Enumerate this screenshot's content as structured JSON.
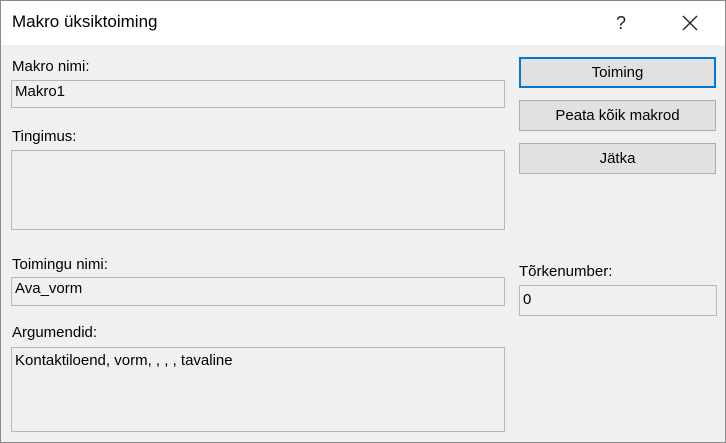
{
  "window": {
    "title": "Makro üksiktoiming",
    "help_label": "?"
  },
  "form": {
    "macro_name_label": "Makro nimi:",
    "macro_name_value": "Makro1",
    "condition_label": "Tingimus:",
    "condition_value": "",
    "action_name_label": "Toimingu nimi:",
    "action_name_value": "Ava_vorm",
    "arguments_label": "Argumendid:",
    "arguments_value": "Kontaktiloend, vorm, , , , tavaline",
    "error_number_label": "Tõrkenumber:",
    "error_number_value": "0"
  },
  "buttons": {
    "step_label": "Toiming",
    "stop_all_label": "Peata kõik makrod",
    "continue_label": "Jätka"
  },
  "icons": {
    "close": "close-icon"
  }
}
